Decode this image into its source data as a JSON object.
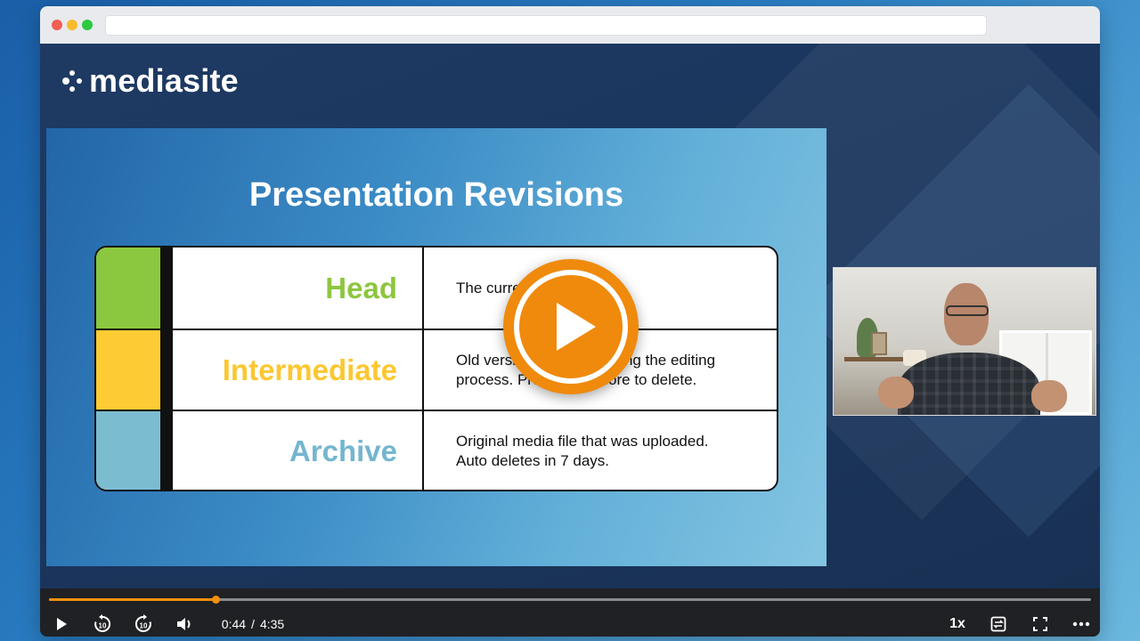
{
  "brand": {
    "name": "mediasite"
  },
  "slide": {
    "title": "Presentation Revisions",
    "rows": [
      {
        "name": "Head",
        "color": "#8dc63f",
        "swatch": "#8cc83f",
        "description": "The current version."
      },
      {
        "name": "Intermediate",
        "color": "#fcc730",
        "swatch": "#fdcb33",
        "description": "Old versions created during the editing process. Prompted before to delete."
      },
      {
        "name": "Archive",
        "color": "#74b6cf",
        "swatch": "#7cbcd1",
        "description": "Original media file that was uploaded.\nAuto deletes in 7 days."
      }
    ]
  },
  "player": {
    "current_time": "0:44",
    "separator": "/",
    "duration": "4:35",
    "progress": 0.16,
    "speed": "1x",
    "accent_color": "#f3900f"
  },
  "icons": {
    "play": "play-icon",
    "rewind": "rewind-10-icon",
    "forward": "forward-10-icon",
    "volume": "volume-icon",
    "captions": "swap-icon",
    "fullscreen": "fullscreen-icon",
    "more": "more-icon"
  }
}
